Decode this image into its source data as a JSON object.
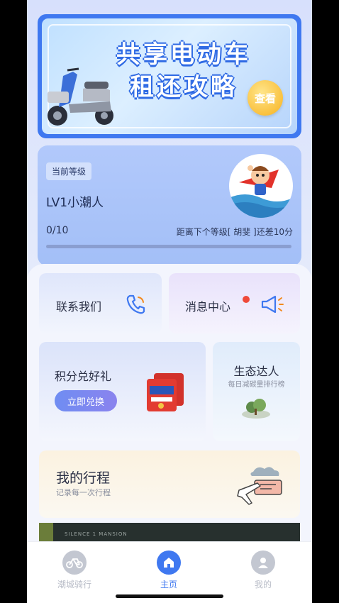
{
  "banner": {
    "title_line1": "共享电动车",
    "title_line2": "租还攻略",
    "button": "查看"
  },
  "level": {
    "tag": "当前等级",
    "name": "LV1小潮人",
    "count": "0/10",
    "hint": "距离下个等级[ 胡斐 ]还差10分",
    "progress": 0
  },
  "contact": {
    "label": "联系我们",
    "icon": "phone-icon"
  },
  "messages": {
    "label": "消息中心",
    "icon": "megaphone-icon",
    "has_unread": true
  },
  "points": {
    "title": "积分兑好礼",
    "button": "立即兑换"
  },
  "eco": {
    "title": "生态达人",
    "subtitle": "每日减碳量排行榜"
  },
  "trip": {
    "title": "我的行程",
    "subtitle": "记录每一次行程"
  },
  "ad": {
    "text": "SILENCE 1 MANSION"
  },
  "tabs": [
    {
      "label": "潮城骑行",
      "icon": "bike-icon",
      "active": false
    },
    {
      "label": "主页",
      "icon": "home-icon",
      "active": true
    },
    {
      "label": "我的",
      "icon": "user-icon",
      "active": false
    }
  ],
  "colors": {
    "accent": "#3f78f0",
    "inactive": "#c3c7d1"
  }
}
